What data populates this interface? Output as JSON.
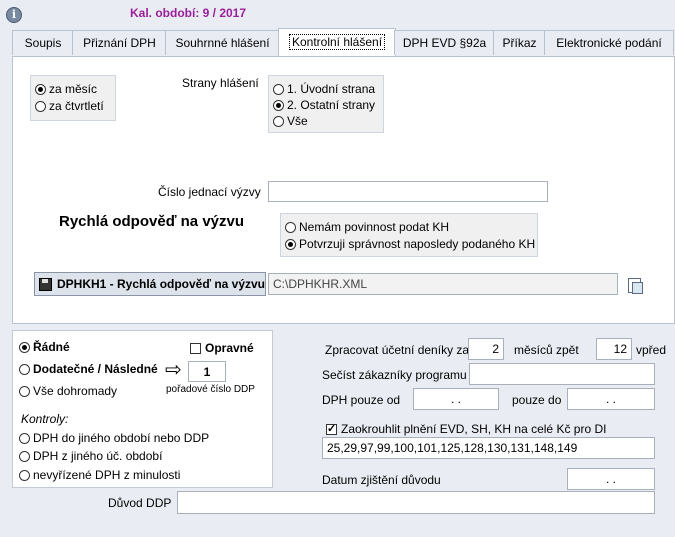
{
  "header": {
    "period": "Kal. období: 9 / 2017"
  },
  "tabs": [
    {
      "label": "Soupis"
    },
    {
      "label": "Přiznání DPH"
    },
    {
      "label": "Souhrnné hlášení"
    },
    {
      "label": "Kontrolní hlášení",
      "active": true
    },
    {
      "label": "DPH EVD §92a"
    },
    {
      "label": "Příkaz"
    },
    {
      "label": "Elektronické podání"
    }
  ],
  "period_options": [
    {
      "label": "za měsíc",
      "selected": true
    },
    {
      "label": "za čtvrtletí",
      "selected": false
    }
  ],
  "pages": {
    "label": "Strany hlášení",
    "options": [
      {
        "label": "1. Úvodní strana",
        "selected": false
      },
      {
        "label": "2. Ostatní strany",
        "selected": true
      },
      {
        "label": "Vše",
        "selected": false
      }
    ]
  },
  "summons": {
    "number_label": "Číslo jednací výzvy",
    "number_value": "",
    "quick_reply_title": "Rychlá odpověď na výzvu",
    "options": [
      {
        "label": "Nemám povinnost podat KH",
        "selected": false
      },
      {
        "label": "Potvrzuji správnost naposledy podaného KH",
        "selected": true
      }
    ]
  },
  "export": {
    "button_label": "DPHKH1 - Rychlá odpověď na výzvu",
    "path": "C:\\DPHKHR.XML"
  },
  "filing": {
    "options": [
      {
        "label": "Řádné",
        "selected": true,
        "bold": true
      },
      {
        "label": "Dodatečné / Následné",
        "selected": false,
        "bold": true
      },
      {
        "label": "Vše dohromady",
        "selected": false
      }
    ],
    "corrective_label": "Opravné",
    "corrective_checked": false,
    "ddp_number": "1",
    "ddp_number_label": "pořadové číslo DDP"
  },
  "checks": {
    "title": "Kontroly:",
    "options": [
      {
        "label": "DPH do jiného období nebo DDP",
        "selected": false
      },
      {
        "label": "DPH z jiného úč. období",
        "selected": false
      },
      {
        "label": "nevyřízené DPH z minulosti",
        "selected": false
      }
    ]
  },
  "processing": {
    "journals_label": "Zpracovat účetní deníky za",
    "months_back": "2",
    "months_back_label": "měsíců zpět",
    "months_forward": "12",
    "months_forward_label": "vpřed",
    "customers_label": "Sečíst zákazníky programu",
    "customers_value": "",
    "vat_from_label": "DPH pouze od",
    "vat_from_value": ". .",
    "vat_to_label": "pouze do",
    "vat_to_value": ". .",
    "round_label": "Zaokrouhlit plnění EVD, SH, KH na celé Kč pro DI",
    "round_checked": true,
    "round_codes": "25,29,97,99,100,101,125,128,130,131,148,149",
    "discovery_date_label": "Datum zjištění důvodu",
    "discovery_date_value": ". ."
  },
  "ddp_reason": {
    "label": "Důvod DDP",
    "value": ""
  }
}
